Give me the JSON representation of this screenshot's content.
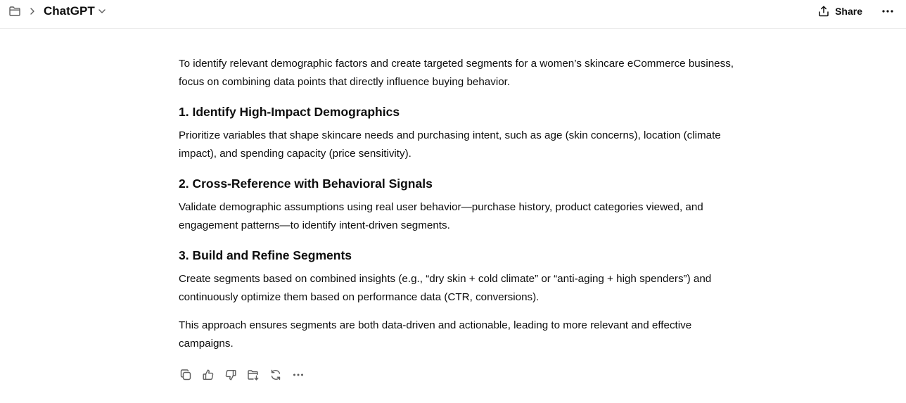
{
  "header": {
    "model_name": "ChatGPT",
    "share_label": "Share",
    "icons": [
      "folder-icon",
      "chevron-right-icon",
      "chevron-down-icon",
      "share-icon",
      "more-icon"
    ]
  },
  "message": {
    "intro": "To identify relevant demographic factors and create targeted segments for a women’s skincare eCommerce business, focus on combining data points that directly influence buying behavior.",
    "sections": [
      {
        "heading": "1. Identify High-Impact Demographics",
        "text": "Prioritize variables that shape skincare needs and purchasing intent, such as age (skin concerns), location (climate impact), and spending capacity (price sensitivity)."
      },
      {
        "heading": "2. Cross-Reference with Behavioral Signals",
        "text": "Validate demographic assumptions using real user behavior—purchase history, product categories viewed, and engagement patterns—to identify intent-driven segments."
      },
      {
        "heading": "3. Build and Refine Segments",
        "text": "Create segments based on combined insights (e.g., “dry skin + cold climate” or “anti-aging + high spenders”) and continuously optimize them based on performance data (CTR, conversions)."
      }
    ],
    "closing": "This approach ensures segments are both data-driven and actionable, leading to more relevant and effective campaigns."
  },
  "actions": [
    "copy-icon",
    "thumbs-up-icon",
    "thumbs-down-icon",
    "canvas-icon",
    "regenerate-icon",
    "more-icon"
  ],
  "colors": {
    "text": "#0d0d0d",
    "icon": "#5d5d5d",
    "border": "#ececec"
  }
}
